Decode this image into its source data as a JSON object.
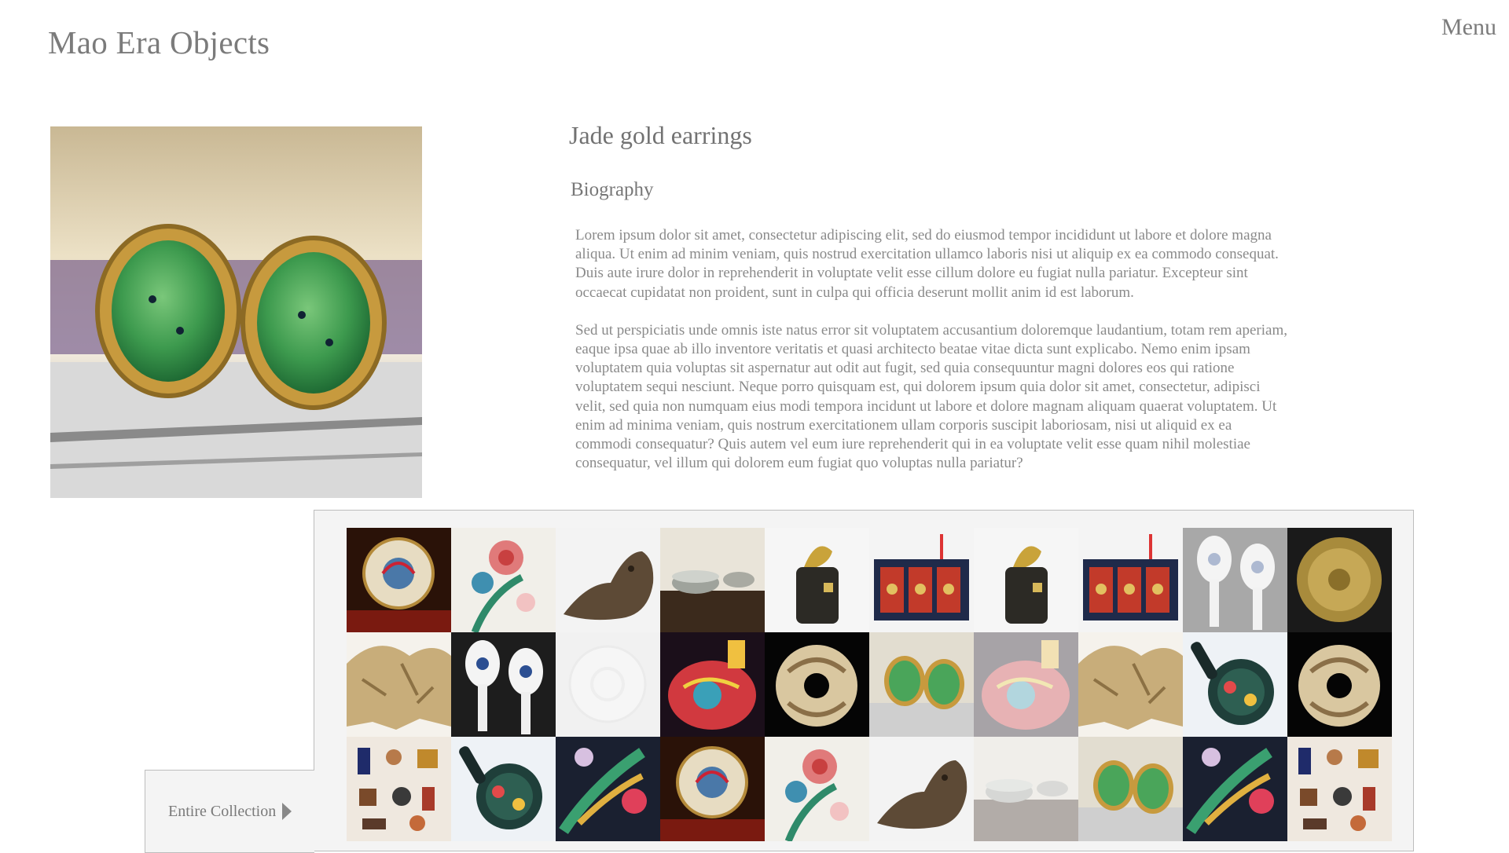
{
  "header": {
    "site_title": "Mao Era Objects",
    "menu_label": "Menu"
  },
  "item": {
    "title": "Jade gold earrings",
    "section_heading": "Biography",
    "paragraphs": [
      "Lorem ipsum dolor sit amet, consectetur adipiscing elit, sed do eiusmod tempor incididunt ut labore et dolore magna aliqua. Ut enim ad minim veniam, quis nostrud exercitation ullamco laboris nisi ut aliquip ex ea commodo consequat. Duis aute irure dolor in reprehenderit in voluptate velit esse cillum dolore eu fugiat nulla pariatur. Excepteur sint occaecat cupidatat non proident, sunt in culpa qui officia deserunt mollit anim id est laborum.",
      "Sed ut perspiciatis unde omnis iste natus error sit voluptatem accusantium doloremque laudantium, totam rem aperiam, eaque ipsa quae ab illo inventore veritatis et quasi architecto beatae vitae dicta sunt explicabo. Nemo enim ipsam voluptatem quia voluptas sit aspernatur aut odit aut fugit, sed quia consequuntur magni dolores eos qui ratione voluptatem sequi nesciunt. Neque porro quisquam est, qui dolorem ipsum quia dolor sit amet, consectetur, adipisci velit, sed quia non numquam eius modi tempora incidunt ut labore et dolore magnam aliquam quaerat voluptatem. Ut enim ad minima veniam, quis nostrum exercitationem ullam corporis suscipit laboriosam, nisi ut aliquid ex ea commodi consequatur? Quis autem vel eum iure reprehenderit qui in ea voluptate velit esse quam nihil molestiae consequatur, vel illum qui dolorem eum fugiat quo voluptas nulla pariatur?"
    ]
  },
  "collection": {
    "tab_label": "Entire Collection",
    "tiles": [
      {
        "kind": "plate-medallion",
        "dim": false
      },
      {
        "kind": "floral-vase",
        "dim": false
      },
      {
        "kind": "bronze-animal",
        "dim": false
      },
      {
        "kind": "bowls-on-table",
        "dim": false
      },
      {
        "kind": "gold-fish-jar",
        "dim": false
      },
      {
        "kind": "painted-cabinet",
        "dim": false
      },
      {
        "kind": "gold-fish-jar",
        "dim": false
      },
      {
        "kind": "painted-cabinet",
        "dim": false
      },
      {
        "kind": "porcelain-spoons",
        "dim": true
      },
      {
        "kind": "gold-plate",
        "dim": false
      },
      {
        "kind": "carved-rock",
        "dim": false
      },
      {
        "kind": "porcelain-spoons",
        "dim": false
      },
      {
        "kind": "white-disc",
        "dim": true
      },
      {
        "kind": "red-enamel-vase",
        "dim": false
      },
      {
        "kind": "jade-pendant",
        "dim": false
      },
      {
        "kind": "jade-earrings",
        "dim": false
      },
      {
        "kind": "red-enamel-vase",
        "dim": true
      },
      {
        "kind": "carved-rock",
        "dim": false
      },
      {
        "kind": "cloisonne-compact",
        "dim": false
      },
      {
        "kind": "jade-pendant",
        "dim": false
      },
      {
        "kind": "miniature-set",
        "dim": false
      },
      {
        "kind": "cloisonne-compact",
        "dim": false
      },
      {
        "kind": "phoenix-embroidery",
        "dim": false
      },
      {
        "kind": "plate-medallion",
        "dim": false
      },
      {
        "kind": "floral-vase",
        "dim": false
      },
      {
        "kind": "bronze-animal",
        "dim": false
      },
      {
        "kind": "bowls-on-table",
        "dim": true
      },
      {
        "kind": "jade-earrings",
        "dim": false
      },
      {
        "kind": "phoenix-embroidery",
        "dim": false
      },
      {
        "kind": "miniature-set",
        "dim": false
      }
    ]
  }
}
